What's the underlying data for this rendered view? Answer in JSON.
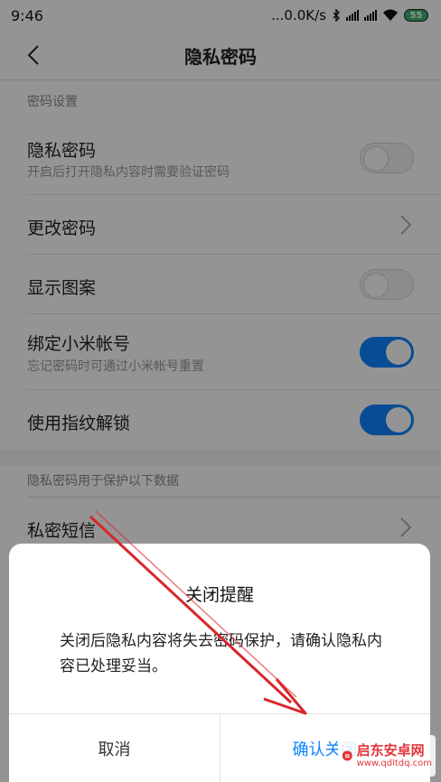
{
  "status_bar": {
    "time": "9:46",
    "network_speed": "...0.0K/s",
    "battery": "55"
  },
  "header": {
    "title": "隐私密码",
    "back_icon": "chevron-left-icon"
  },
  "sections": [
    {
      "label": "密码设置",
      "rows": [
        {
          "title": "隐私密码",
          "subtitle": "开启后打开隐私内容时需要验证密码",
          "control": "toggle",
          "on": false
        },
        {
          "title": "更改密码",
          "control": "chevron"
        },
        {
          "title": "显示图案",
          "control": "toggle",
          "on": false
        },
        {
          "title": "绑定小米帐号",
          "subtitle": "忘记密码时可通过小米帐号重置",
          "control": "toggle",
          "on": true
        },
        {
          "title": "使用指纹解锁",
          "control": "toggle",
          "on": true
        }
      ]
    },
    {
      "label": "隐私密码用于保护以下数据",
      "rows": [
        {
          "title": "私密短信",
          "control": "chevron"
        }
      ]
    }
  ],
  "dialog": {
    "title": "关闭提醒",
    "message": "关闭后隐私内容将失去密码保护，请确认隐私内容已处理妥当。",
    "cancel_label": "取消",
    "confirm_label": "确认关闭"
  },
  "watermark": {
    "name": "启东安卓网",
    "url": "www.qdltdq.com"
  },
  "colors": {
    "accent": "#0d84ff",
    "annotation_arrow": "#d9262a",
    "watermark": "#e3373b"
  }
}
